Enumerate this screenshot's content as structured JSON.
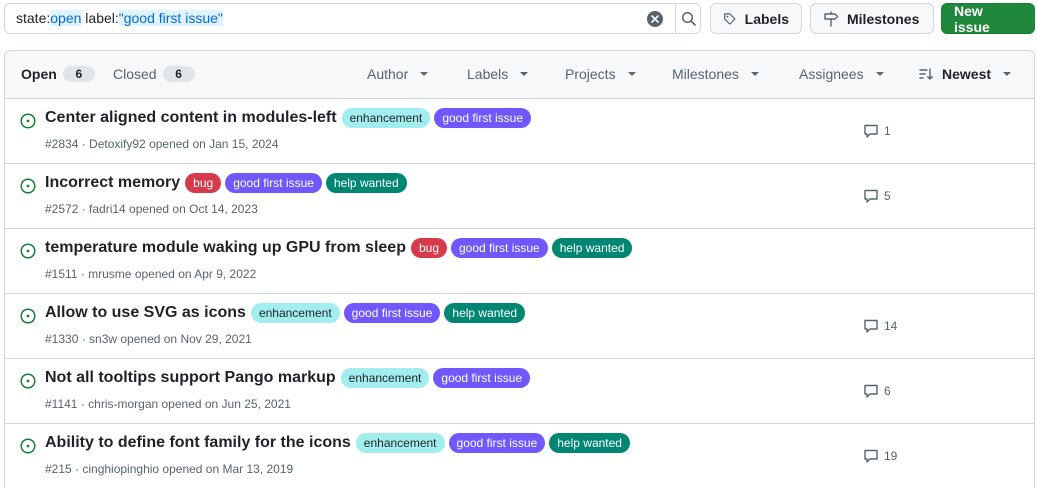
{
  "search": {
    "prefix": "state:",
    "state_value": "open",
    "middle": " label:",
    "label_value": "\"good first issue\""
  },
  "buttons": {
    "labels": "Labels",
    "milestones": "Milestones",
    "new_issue": "New issue"
  },
  "header": {
    "open_label": "Open",
    "open_count": "6",
    "closed_label": "Closed",
    "closed_count": "6",
    "filters": {
      "author": "Author",
      "labels": "Labels",
      "projects": "Projects",
      "milestones": "Milestones",
      "assignees": "Assignees",
      "sort": "Newest"
    }
  },
  "label_colors": {
    "enhancement": {
      "bg": "#a2eeef",
      "fg": "#1f2328"
    },
    "good first issue": {
      "bg": "#7057ff",
      "fg": "#ffffff"
    },
    "bug": {
      "bg": "#d73a4a",
      "fg": "#ffffff"
    },
    "help wanted": {
      "bg": "#008672",
      "fg": "#ffffff"
    }
  },
  "issues": [
    {
      "title": "Center aligned content in modules-left",
      "labels": [
        "enhancement",
        "good first issue"
      ],
      "meta": "#2834 · Detoxify92 opened on Jan 15, 2024",
      "comments": "1"
    },
    {
      "title": "Incorrect memory",
      "labels": [
        "bug",
        "good first issue",
        "help wanted"
      ],
      "meta": "#2572 · fadri14 opened on Oct 14, 2023",
      "comments": "5"
    },
    {
      "title": "temperature module waking up GPU from sleep",
      "labels": [
        "bug",
        "good first issue",
        "help wanted"
      ],
      "meta": "#1511 · mrusme opened on Apr 9, 2022",
      "comments": ""
    },
    {
      "title": "Allow to use SVG as icons",
      "labels": [
        "enhancement",
        "good first issue",
        "help wanted"
      ],
      "meta": "#1330 · sn3w opened on Nov 29, 2021",
      "comments": "14"
    },
    {
      "title": "Not all tooltips support Pango markup",
      "labels": [
        "enhancement",
        "good first issue"
      ],
      "meta": "#1141 · chris-morgan opened on Jun 25, 2021",
      "comments": "6"
    },
    {
      "title": "Ability to define font family for the icons",
      "labels": [
        "enhancement",
        "good first issue",
        "help wanted"
      ],
      "meta": "#215 · cinghiopinghio opened on Mar 13, 2019",
      "comments": "19"
    }
  ],
  "icons": {
    "issue_open": "issue-opened-icon",
    "comment": "comment-icon",
    "tag": "tag-icon",
    "milestone": "milestone-icon",
    "search": "search-icon",
    "clear": "clear-x-icon",
    "sort": "sort-desc-icon"
  },
  "colors": {
    "open_green": "#1a7f37",
    "primary_button": "#1f883d",
    "highlight_bg": "#ddf4ff",
    "highlight_fg": "#0969da"
  }
}
